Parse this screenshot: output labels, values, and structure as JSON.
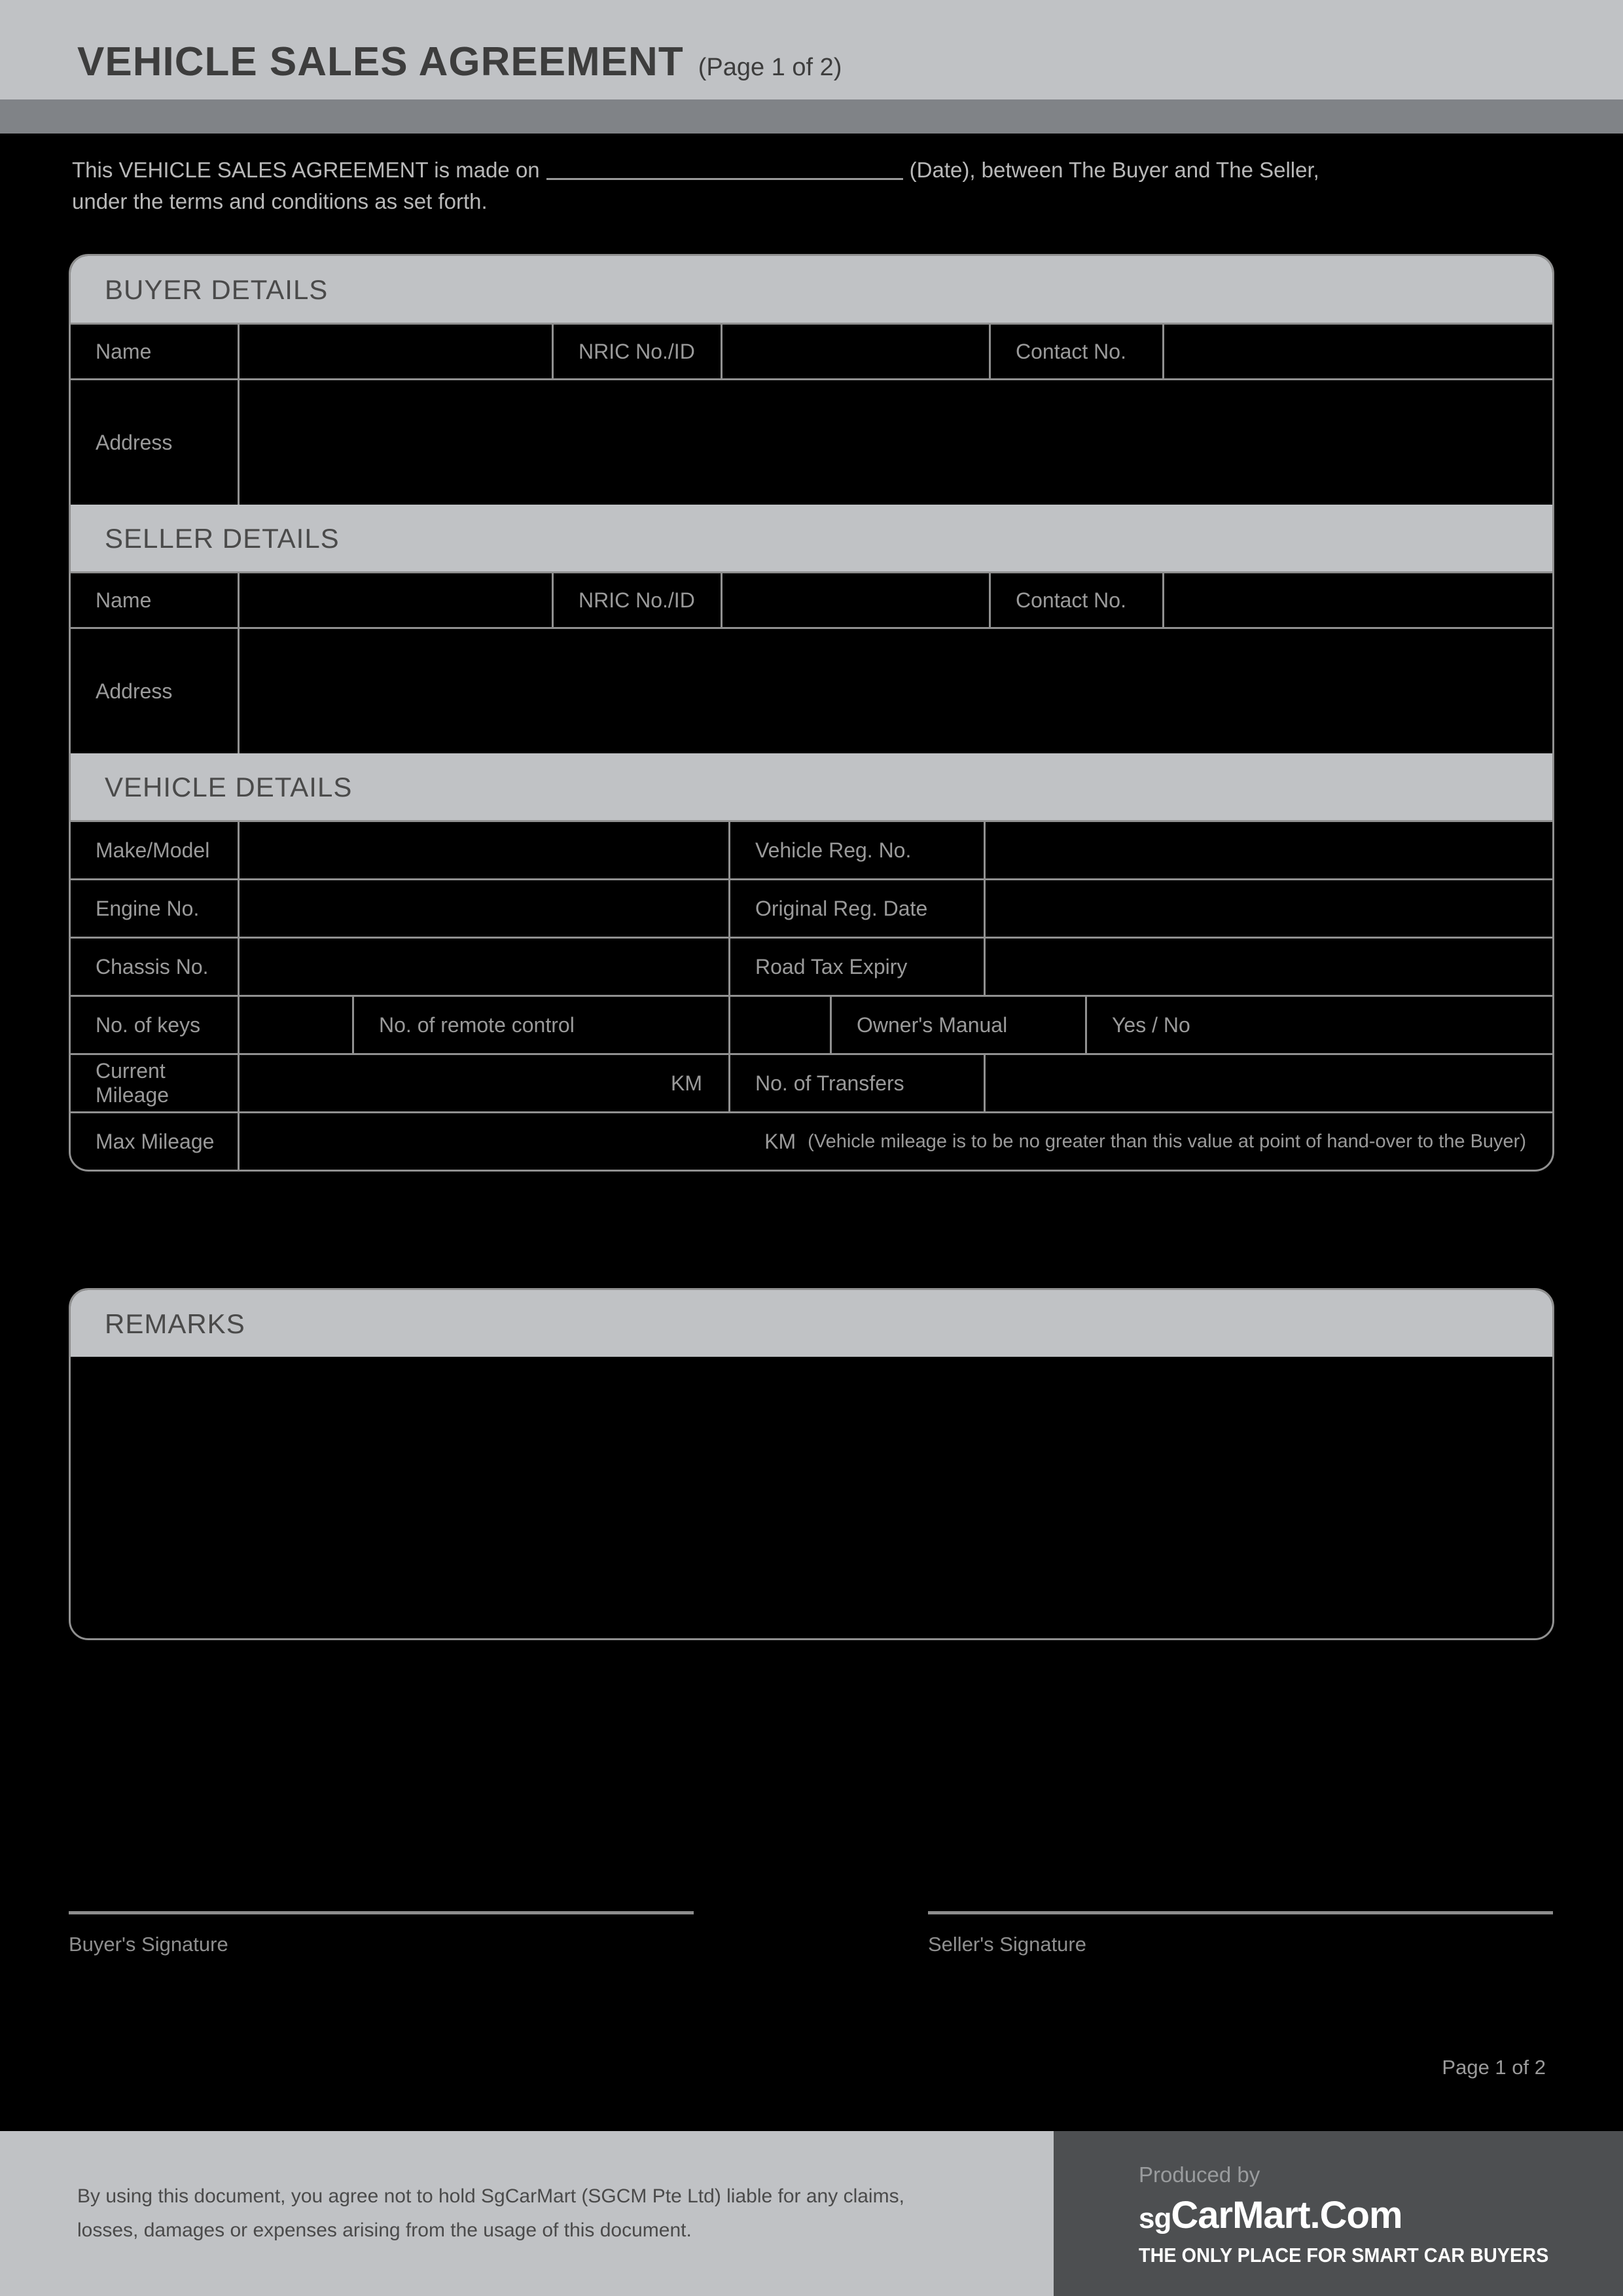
{
  "header": {
    "title": "VEHICLE SALES AGREEMENT",
    "page_label": "(Page 1 of 2)"
  },
  "intro": {
    "before": "This VEHICLE SALES AGREEMENT is made on",
    "after": "(Date), between The Buyer and The Seller,",
    "line2": "under the terms and conditions as set forth."
  },
  "buyer": {
    "section_title": "BUYER DETAILS",
    "name_label": "Name",
    "name_value": "",
    "nric_label": "NRIC No./ID",
    "nric_value": "",
    "contact_label": "Contact No.",
    "contact_value": "",
    "address_label": "Address",
    "address_value": ""
  },
  "seller": {
    "section_title": "SELLER DETAILS",
    "name_label": "Name",
    "name_value": "",
    "nric_label": "NRIC No./ID",
    "nric_value": "",
    "contact_label": "Contact No.",
    "contact_value": "",
    "address_label": "Address",
    "address_value": ""
  },
  "vehicle": {
    "section_title": "VEHICLE DETAILS",
    "make_label": "Make/Model",
    "make_value": "",
    "regno_label": "Vehicle Reg. No.",
    "regno_value": "",
    "engine_label": "Engine No.",
    "engine_value": "",
    "origdate_label": "Original Reg. Date",
    "origdate_value": "",
    "chassis_label": "Chassis No.",
    "chassis_value": "",
    "roadtax_label": "Road Tax Expiry",
    "roadtax_value": "",
    "keys_label": "No. of keys",
    "keys_value": "",
    "remote_label": "No. of remote control",
    "remote_value": "",
    "manual_label": "Owner's Manual",
    "manual_options": "Yes  /  No",
    "curmileage_label": "Current Mileage",
    "curmileage_unit": "KM",
    "transfers_label": "No. of Transfers",
    "transfers_value": "",
    "maxmileage_label": "Max Mileage",
    "maxmileage_unit": "KM",
    "maxmileage_note": "(Vehicle mileage is to be no greater than this value at point of hand-over to the Buyer)"
  },
  "remarks": {
    "section_title": "REMARKS",
    "body": ""
  },
  "signatures": {
    "buyer_label": "Buyer's Signature",
    "seller_label": "Seller's Signature"
  },
  "page_footer": {
    "page_number": "Page 1 of 2"
  },
  "footer": {
    "disclaimer_line1": "By using this document, you agree not to hold SgCarMart (SGCM Pte Ltd) liable for any claims,",
    "disclaimer_line2": "losses, damages or expenses arising from the usage of this document.",
    "produced_by": "Produced by",
    "brand_sg": "sg",
    "brand_carmart": "CarMart",
    "brand_dot_com": ".Com",
    "tagline": "THE ONLY PLACE FOR SMART CAR BUYERS"
  },
  "colors": {
    "band": "#c0c2c5",
    "strip": "#808387",
    "footer_dark": "#4d4f51",
    "border": "#909090",
    "label_text": "#9a9a9a",
    "section_text": "#4a4a4a"
  }
}
